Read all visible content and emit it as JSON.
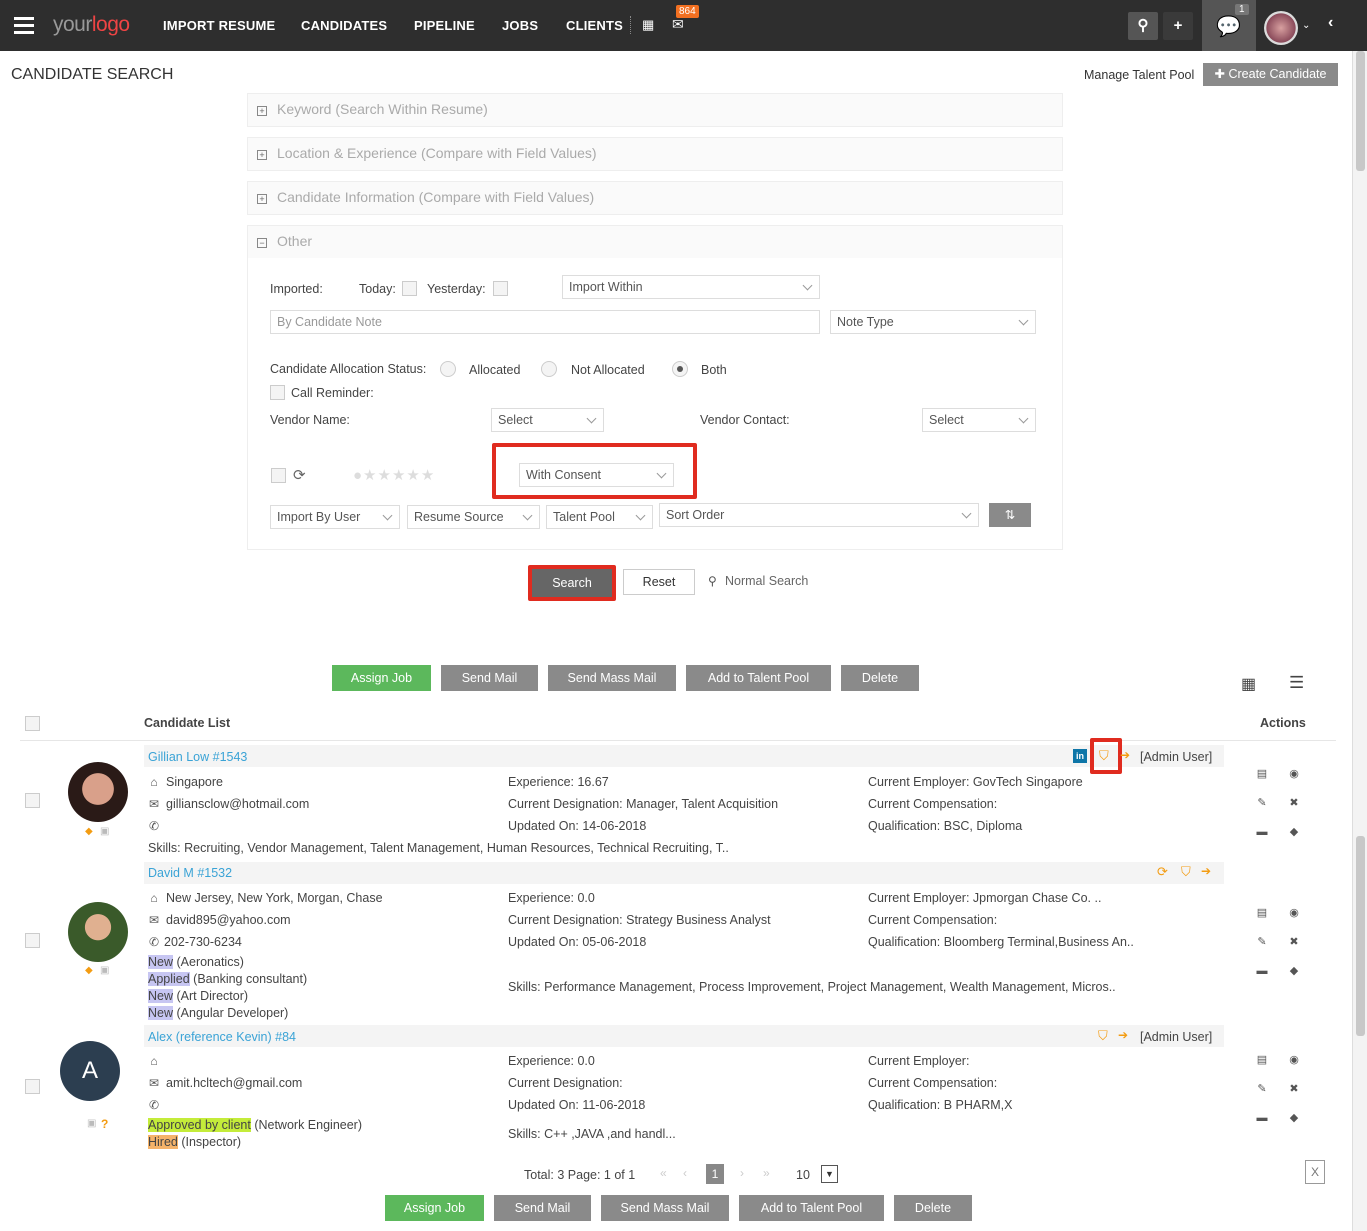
{
  "topbar": {
    "logo_your": "your",
    "logo_logo": "logo",
    "nav": [
      "IMPORT RESUME",
      "CANDIDATES",
      "PIPELINE",
      "JOBS",
      "CLIENTS"
    ],
    "mail_badge": "864",
    "chat_badge": "1"
  },
  "page": {
    "title": "CANDIDATE SEARCH",
    "manage_talent_pool": "Manage Talent Pool",
    "create_candidate": "Create Candidate"
  },
  "filters": {
    "keyword": "Keyword (Search Within Resume)",
    "location": "Location & Experience (Compare with Field Values)",
    "candidate_info": "Candidate Information (Compare with Field Values)",
    "other": "Other",
    "imported_label": "Imported:",
    "today_label": "Today:",
    "yesterday_label": "Yesterday:",
    "import_within": "Import Within",
    "candidate_note_placeholder": "By Candidate Note",
    "note_type": "Note Type",
    "allocation_label": "Candidate Allocation Status:",
    "allocated": "Allocated",
    "not_allocated": "Not Allocated",
    "both": "Both",
    "call_reminder": "Call Reminder:",
    "vendor_name_label": "Vendor Name:",
    "vendor_name_select": "Select",
    "vendor_contact_label": "Vendor Contact:",
    "vendor_contact_select": "Select",
    "consent_select": "With Consent",
    "import_by_user": "Import By User",
    "resume_source": "Resume Source",
    "talent_pool": "Talent Pool",
    "sort_order": "Sort Order"
  },
  "search_actions": {
    "search": "Search",
    "reset": "Reset",
    "normal_search": "Normal Search"
  },
  "bulk_actions": {
    "assign_job": "Assign Job",
    "send_mail": "Send Mail",
    "send_mass_mail": "Send Mass Mail",
    "add_to_talent_pool": "Add to Talent Pool",
    "delete": "Delete"
  },
  "list": {
    "header": "Candidate List",
    "actions_header": "Actions"
  },
  "candidates": [
    {
      "name": "Gillian Low #1543",
      "admin": "[Admin User]",
      "location": "Singapore",
      "email": "gilliansclow@hotmail.com",
      "phone": "",
      "experience": "Experience: 16.67",
      "designation": "Current Designation: Manager, Talent Acquisition",
      "updated": "Updated On: 14-06-2018",
      "employer": "Current Employer: GovTech Singapore",
      "compensation": "Current Compensation:",
      "qualification": "Qualification: BSC, Diploma",
      "skills": "Skills: Recruiting, Vendor Management, Talent Management, Human Resources, Technical Recruiting, T.."
    },
    {
      "name": "David M #1532",
      "admin": "",
      "location": "New Jersey, New York, Morgan, Chase",
      "email": "david895@yahoo.com",
      "phone": "202-730-6234",
      "experience": "Experience: 0.0",
      "designation": "Current Designation: Strategy Business Analyst",
      "updated": "Updated On: 05-06-2018",
      "employer": "Current Employer: Jpmorgan Chase Co. ..",
      "compensation": "Current Compensation:",
      "qualification": "Qualification: Bloomberg Terminal,Business An..",
      "skills": "Skills: Performance Management, Process Improvement, Project Management, Wealth Management, Micros..",
      "pipeline": [
        {
          "status": "New",
          "job": " (Aeronatics)"
        },
        {
          "status": "Applied",
          "job": " (Banking consultant)"
        },
        {
          "status": "New",
          "job": " (Art Director)"
        },
        {
          "status": "New",
          "job": " (Angular Developer)"
        }
      ]
    },
    {
      "name": "Alex (reference Kevin) #84",
      "admin": "[Admin User]",
      "initial": "A",
      "location": "",
      "email": "amit.hcltech@gmail.com",
      "phone": "",
      "experience": "Experience: 0.0",
      "designation": "Current Designation:",
      "updated": "Updated On: 11-06-2018",
      "employer": "Current Employer:",
      "compensation": "Current Compensation:",
      "qualification": "Qualification: B PHARM,X",
      "skills": "Skills: C++ ,JAVA ,and handl...",
      "pipeline": [
        {
          "status": "Approved by client",
          "job": " (Network Engineer)"
        },
        {
          "status": "Hired",
          "job": " (Inspector)"
        }
      ]
    }
  ],
  "pagination": {
    "total": "Total: 3 Page: 1 of 1",
    "current_page": "1",
    "page_size": "10"
  },
  "colors": {
    "accent_red": "#e02b1f",
    "green": "#5cb85c",
    "link_blue": "#3aa3d6",
    "topbar": "#2e2e2e"
  }
}
